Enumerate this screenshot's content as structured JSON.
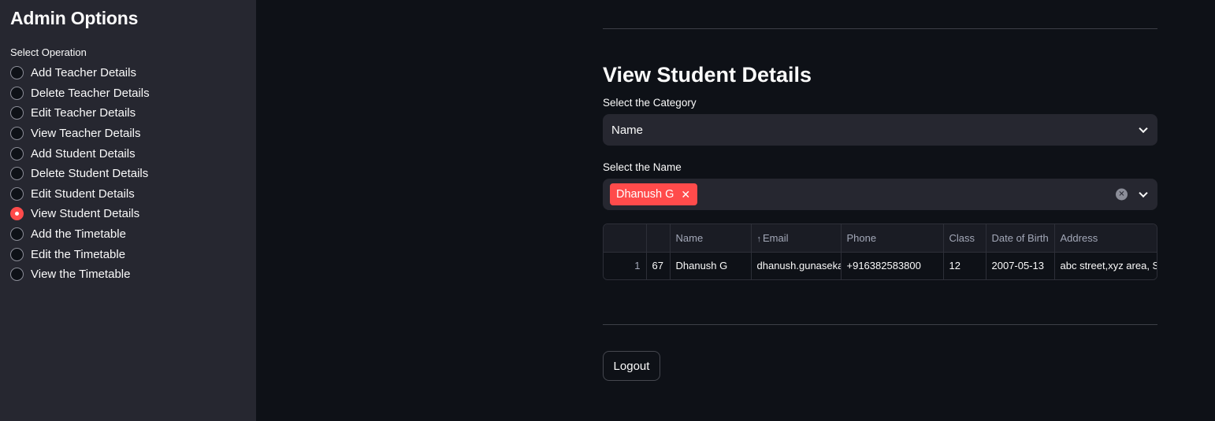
{
  "sidebar": {
    "title": "Admin Options",
    "radio_caption": "Select Operation",
    "options": [
      {
        "label": "Add Teacher Details",
        "selected": false
      },
      {
        "label": "Delete Teacher Details",
        "selected": false
      },
      {
        "label": "Edit Teacher Details",
        "selected": false
      },
      {
        "label": "View Teacher Details",
        "selected": false
      },
      {
        "label": "Add Student Details",
        "selected": false
      },
      {
        "label": "Delete Student Details",
        "selected": false
      },
      {
        "label": "Edit Student Details",
        "selected": false
      },
      {
        "label": "View Student Details",
        "selected": true
      },
      {
        "label": "Add the Timetable",
        "selected": false
      },
      {
        "label": "Edit the Timetable",
        "selected": false
      },
      {
        "label": "View the Timetable",
        "selected": false
      }
    ]
  },
  "main": {
    "title": "View Student Details",
    "category_label": "Select the Category",
    "category_value": "Name",
    "name_label": "Select the Name",
    "selected_names": [
      "Dhanush G"
    ],
    "table": {
      "columns": [
        "",
        "",
        "Name",
        "Email",
        "Phone",
        "Class",
        "Date of Birth",
        "Address"
      ],
      "sorted_column": "Email",
      "rows": [
        [
          "1",
          "67",
          "Dhanush G",
          "dhanush.gunasekaran",
          "+916382583800",
          "12",
          "2007-05-13",
          "abc street,xyz area, S"
        ]
      ]
    },
    "logout_label": "Logout"
  },
  "colors": {
    "background": "#0e1117",
    "sidebar": "#262730",
    "accent": "#ff4b4b"
  },
  "icons": {
    "tag_remove": "close-icon",
    "clear": "clear-all-icon",
    "dropdown": "chevron-down-icon",
    "sort": "arrow-up-icon"
  }
}
